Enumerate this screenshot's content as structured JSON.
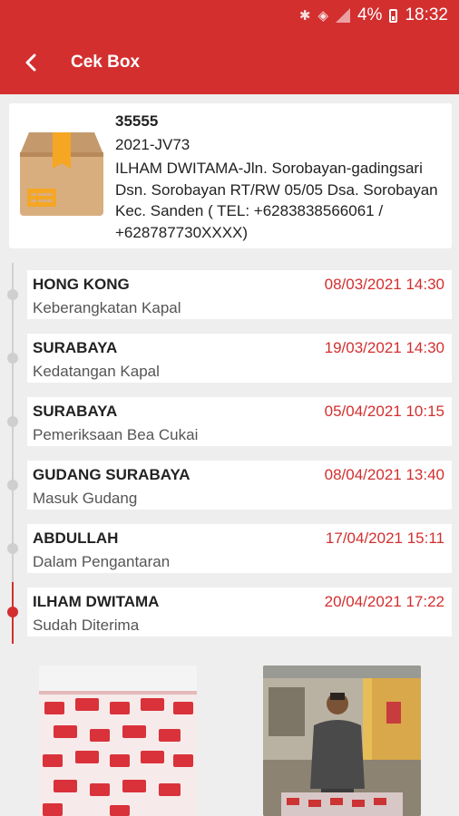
{
  "status_bar": {
    "battery": "4%",
    "time": "18:32"
  },
  "app_bar": {
    "title": "Cek Box"
  },
  "package": {
    "id": "35555",
    "code": "2021-JV73",
    "address": "ILHAM DWITAMA-Jln. Sorobayan-gadingsari Dsn. Sorobayan RT/RW 05/05 Dsa. Sorobayan Kec. Sanden ( TEL: +6283838566061 / +628787730XXXX)"
  },
  "timeline": [
    {
      "location": "HONG KONG",
      "datetime": "08/03/2021 14:30",
      "status": "Keberangkatan Kapal"
    },
    {
      "location": "SURABAYA",
      "datetime": "19/03/2021 14:30",
      "status": "Kedatangan Kapal"
    },
    {
      "location": "SURABAYA",
      "datetime": "05/04/2021 10:15",
      "status": "Pemeriksaan Bea Cukai"
    },
    {
      "location": "GUDANG SURABAYA",
      "datetime": "08/04/2021 13:40",
      "status": "Masuk Gudang"
    },
    {
      "location": "ABDULLAH",
      "datetime": "17/04/2021 15:11",
      "status": "Dalam Pengantaran"
    },
    {
      "location": "ILHAM DWITAMA",
      "datetime": "20/04/2021 17:22",
      "status": "Sudah Diterima"
    }
  ],
  "colors": {
    "accent": "#d32f2f",
    "inactive": "#cfcfcf",
    "background": "#eeeeee"
  },
  "icons": [
    "bluetooth-icon",
    "wifi-icon",
    "signal-icon",
    "battery-icon",
    "back-arrow-icon",
    "package-box-icon"
  ]
}
